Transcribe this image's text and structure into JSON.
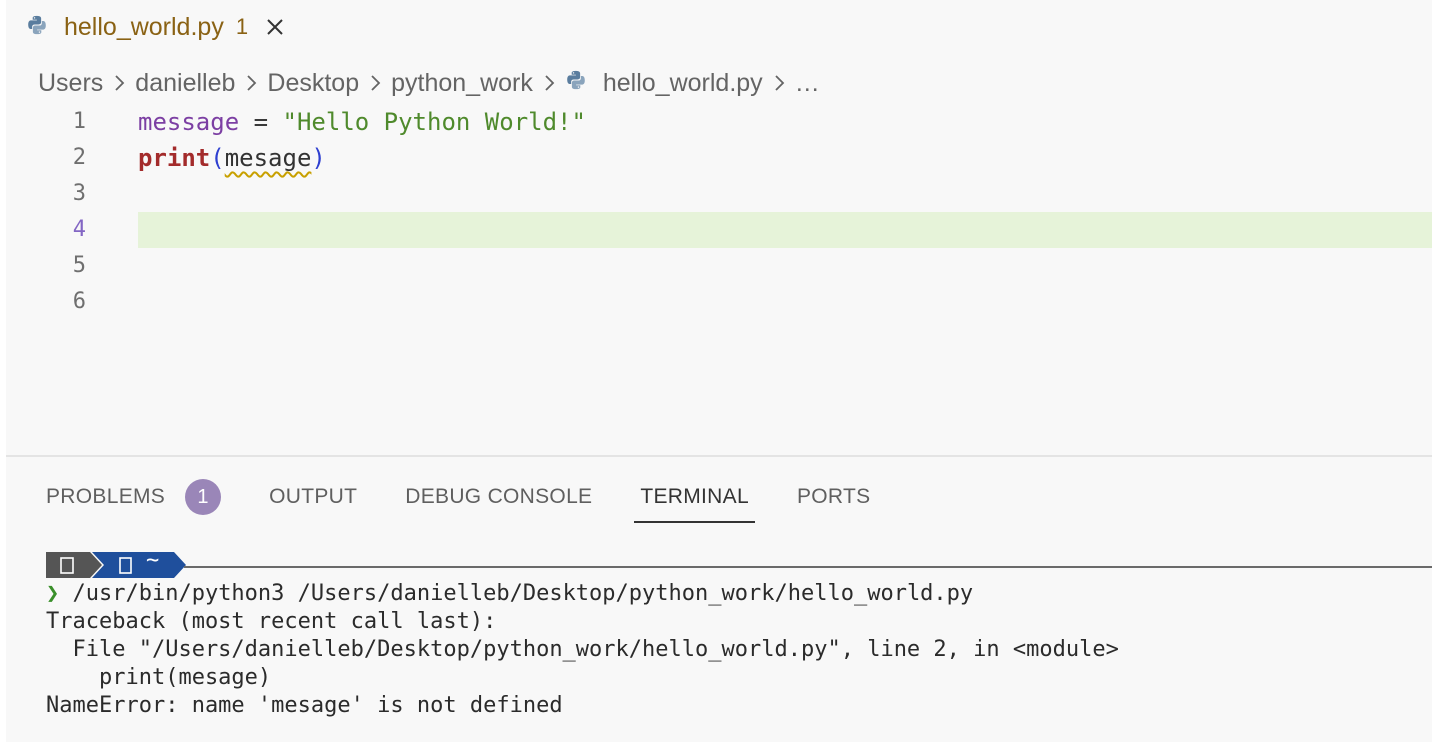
{
  "tab": {
    "filename": "hello_world.py",
    "problem_count": "1",
    "close_glyph": "✕"
  },
  "breadcrumb": {
    "segments": [
      "Users",
      "danielleb",
      "Desktop",
      "python_work"
    ],
    "file": "hello_world.py",
    "more": "…"
  },
  "editor": {
    "active_line": 4,
    "lines": [
      {
        "number": "1",
        "tokens": {
          "var": "message",
          "op": " = ",
          "str": "\"Hello Python World!\""
        }
      },
      {
        "number": "2",
        "tokens": {
          "fn": "print",
          "open": "(",
          "arg": "mesage",
          "close": ")"
        }
      },
      {
        "number": "3"
      },
      {
        "number": "4"
      },
      {
        "number": "5"
      },
      {
        "number": "6"
      }
    ]
  },
  "panel": {
    "tabs": [
      {
        "label": "PROBLEMS",
        "badge": "1"
      },
      {
        "label": "OUTPUT"
      },
      {
        "label": "DEBUG CONSOLE"
      },
      {
        "label": "TERMINAL",
        "active": true
      },
      {
        "label": "PORTS"
      }
    ]
  },
  "terminal": {
    "prompt_home_glyph": "~",
    "lines": [
      {
        "chevron": "❯",
        "text": " /usr/bin/python3 /Users/danielleb/Desktop/python_work/hello_world.py"
      },
      {
        "text": "Traceback (most recent call last):"
      },
      {
        "text": "  File \"/Users/danielleb/Desktop/python_work/hello_world.py\", line 2, in <module>"
      },
      {
        "text": "    print(mesage)"
      },
      {
        "text": "NameError: name 'mesage' is not defined"
      }
    ]
  },
  "colors": {
    "tab_modified_text": "#8a6214",
    "current_line_highlight": "#e6f3d9",
    "badge_bg": "#9a86b8",
    "prompt_segment_dark": "#555555",
    "prompt_segment_blue": "#1f4f9c"
  }
}
